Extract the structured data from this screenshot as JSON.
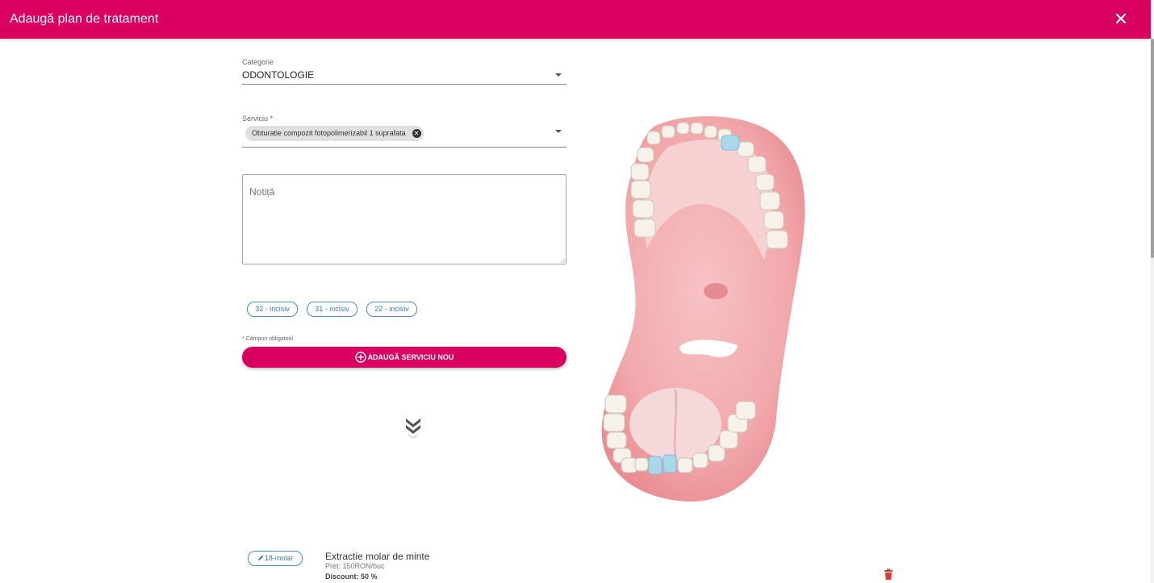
{
  "dialog": {
    "title": "Adaugă plan de tratament",
    "close_icon": "close-icon"
  },
  "form": {
    "category": {
      "label": "Categorie",
      "value": "ODONTOLOGIE"
    },
    "service": {
      "label": "Serviciu *",
      "chip": "Obturatie compozit fotopolimerizabil 1 suprafata"
    },
    "note": {
      "placeholder": "Notiță"
    },
    "teeth": [
      "32 - incisiv",
      "31 - incisiv",
      "22 - incisiv"
    ],
    "required_note": "* Câmpuri obligatorii",
    "add_button": "ADAUGĂ SERVICIU NOU"
  },
  "services": [
    {
      "tooth": "18-molar",
      "name": "Extractie molar de minte",
      "price": "Preț: 150RON/buc",
      "discount": "Discount: 50 %"
    }
  ],
  "colors": {
    "accent": "#d9005f",
    "chip_border": "#4a90c2",
    "tooth_selected": "#a8d8ea",
    "delete": "#e53935"
  },
  "icons": [
    "close-icon",
    "dropdown-arrow-icon",
    "chip-remove-icon",
    "plus-circle-icon",
    "double-chevron-down-icon",
    "pencil-icon",
    "trash-icon",
    "dental-arch-image"
  ]
}
